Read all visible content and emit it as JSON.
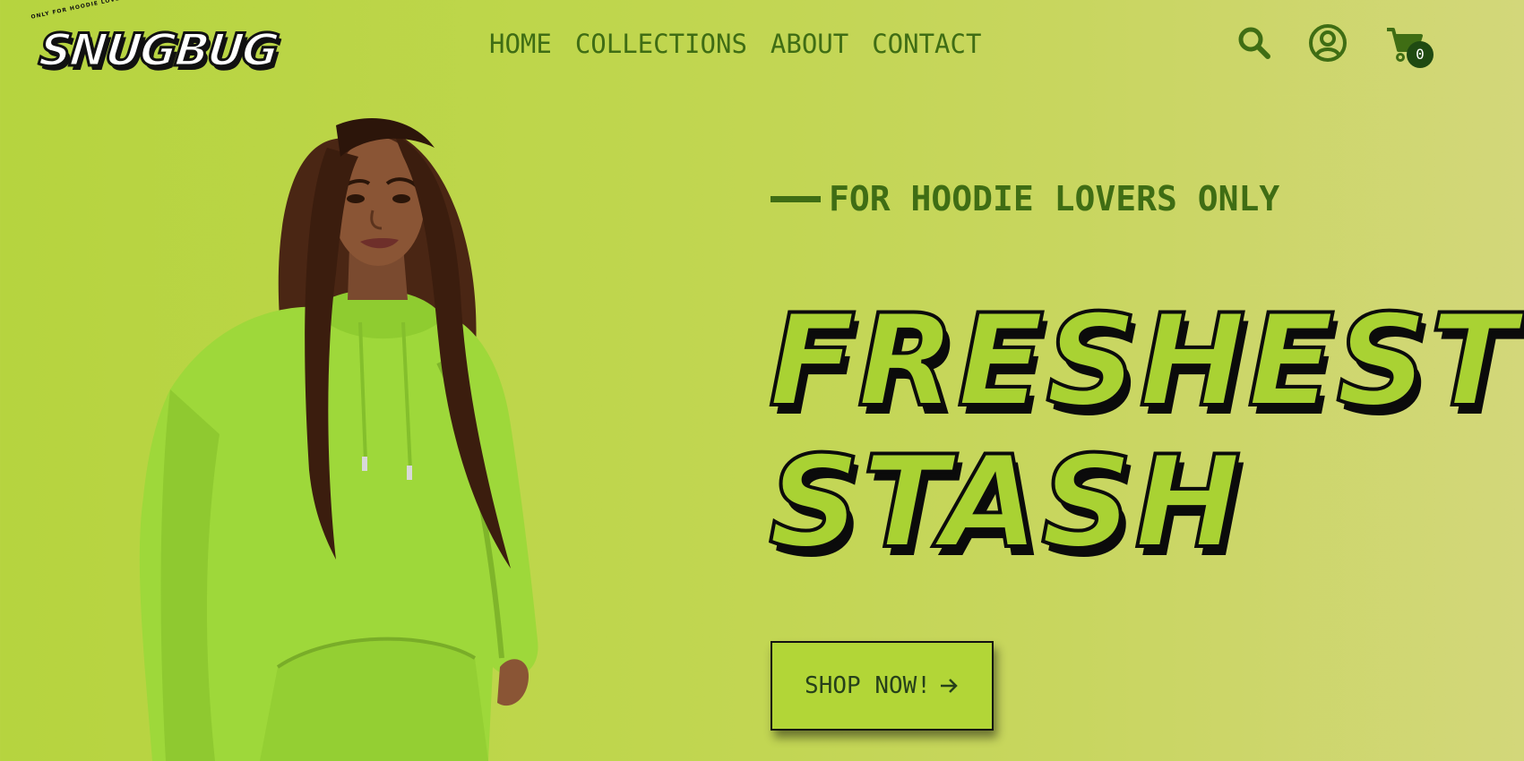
{
  "brand": {
    "tagline": "ONLY FOR HOODIE LOVERS",
    "name": "SNUGBUG"
  },
  "nav": {
    "items": [
      {
        "label": "HOME"
      },
      {
        "label": "COLLECTIONS"
      },
      {
        "label": "ABOUT"
      },
      {
        "label": "CONTACT"
      }
    ]
  },
  "header_icons": {
    "search": "search-icon",
    "account": "user-circle-icon",
    "cart": "cart-icon",
    "cart_count": "0"
  },
  "hero": {
    "eyebrow": "FOR HOODIE LOVERS ONLY",
    "headline_line1": "FRESHEST",
    "headline_line2": "STASH",
    "cta_label": "SHOP NOW!",
    "cta_icon": "arrow-right-icon"
  },
  "colors": {
    "background": "#bfd64d",
    "accent_dark_green": "#3f6d14",
    "headline_fill": "#a9d233",
    "hoodie_green": "#9ed83a",
    "badge": "#1f4a12"
  }
}
